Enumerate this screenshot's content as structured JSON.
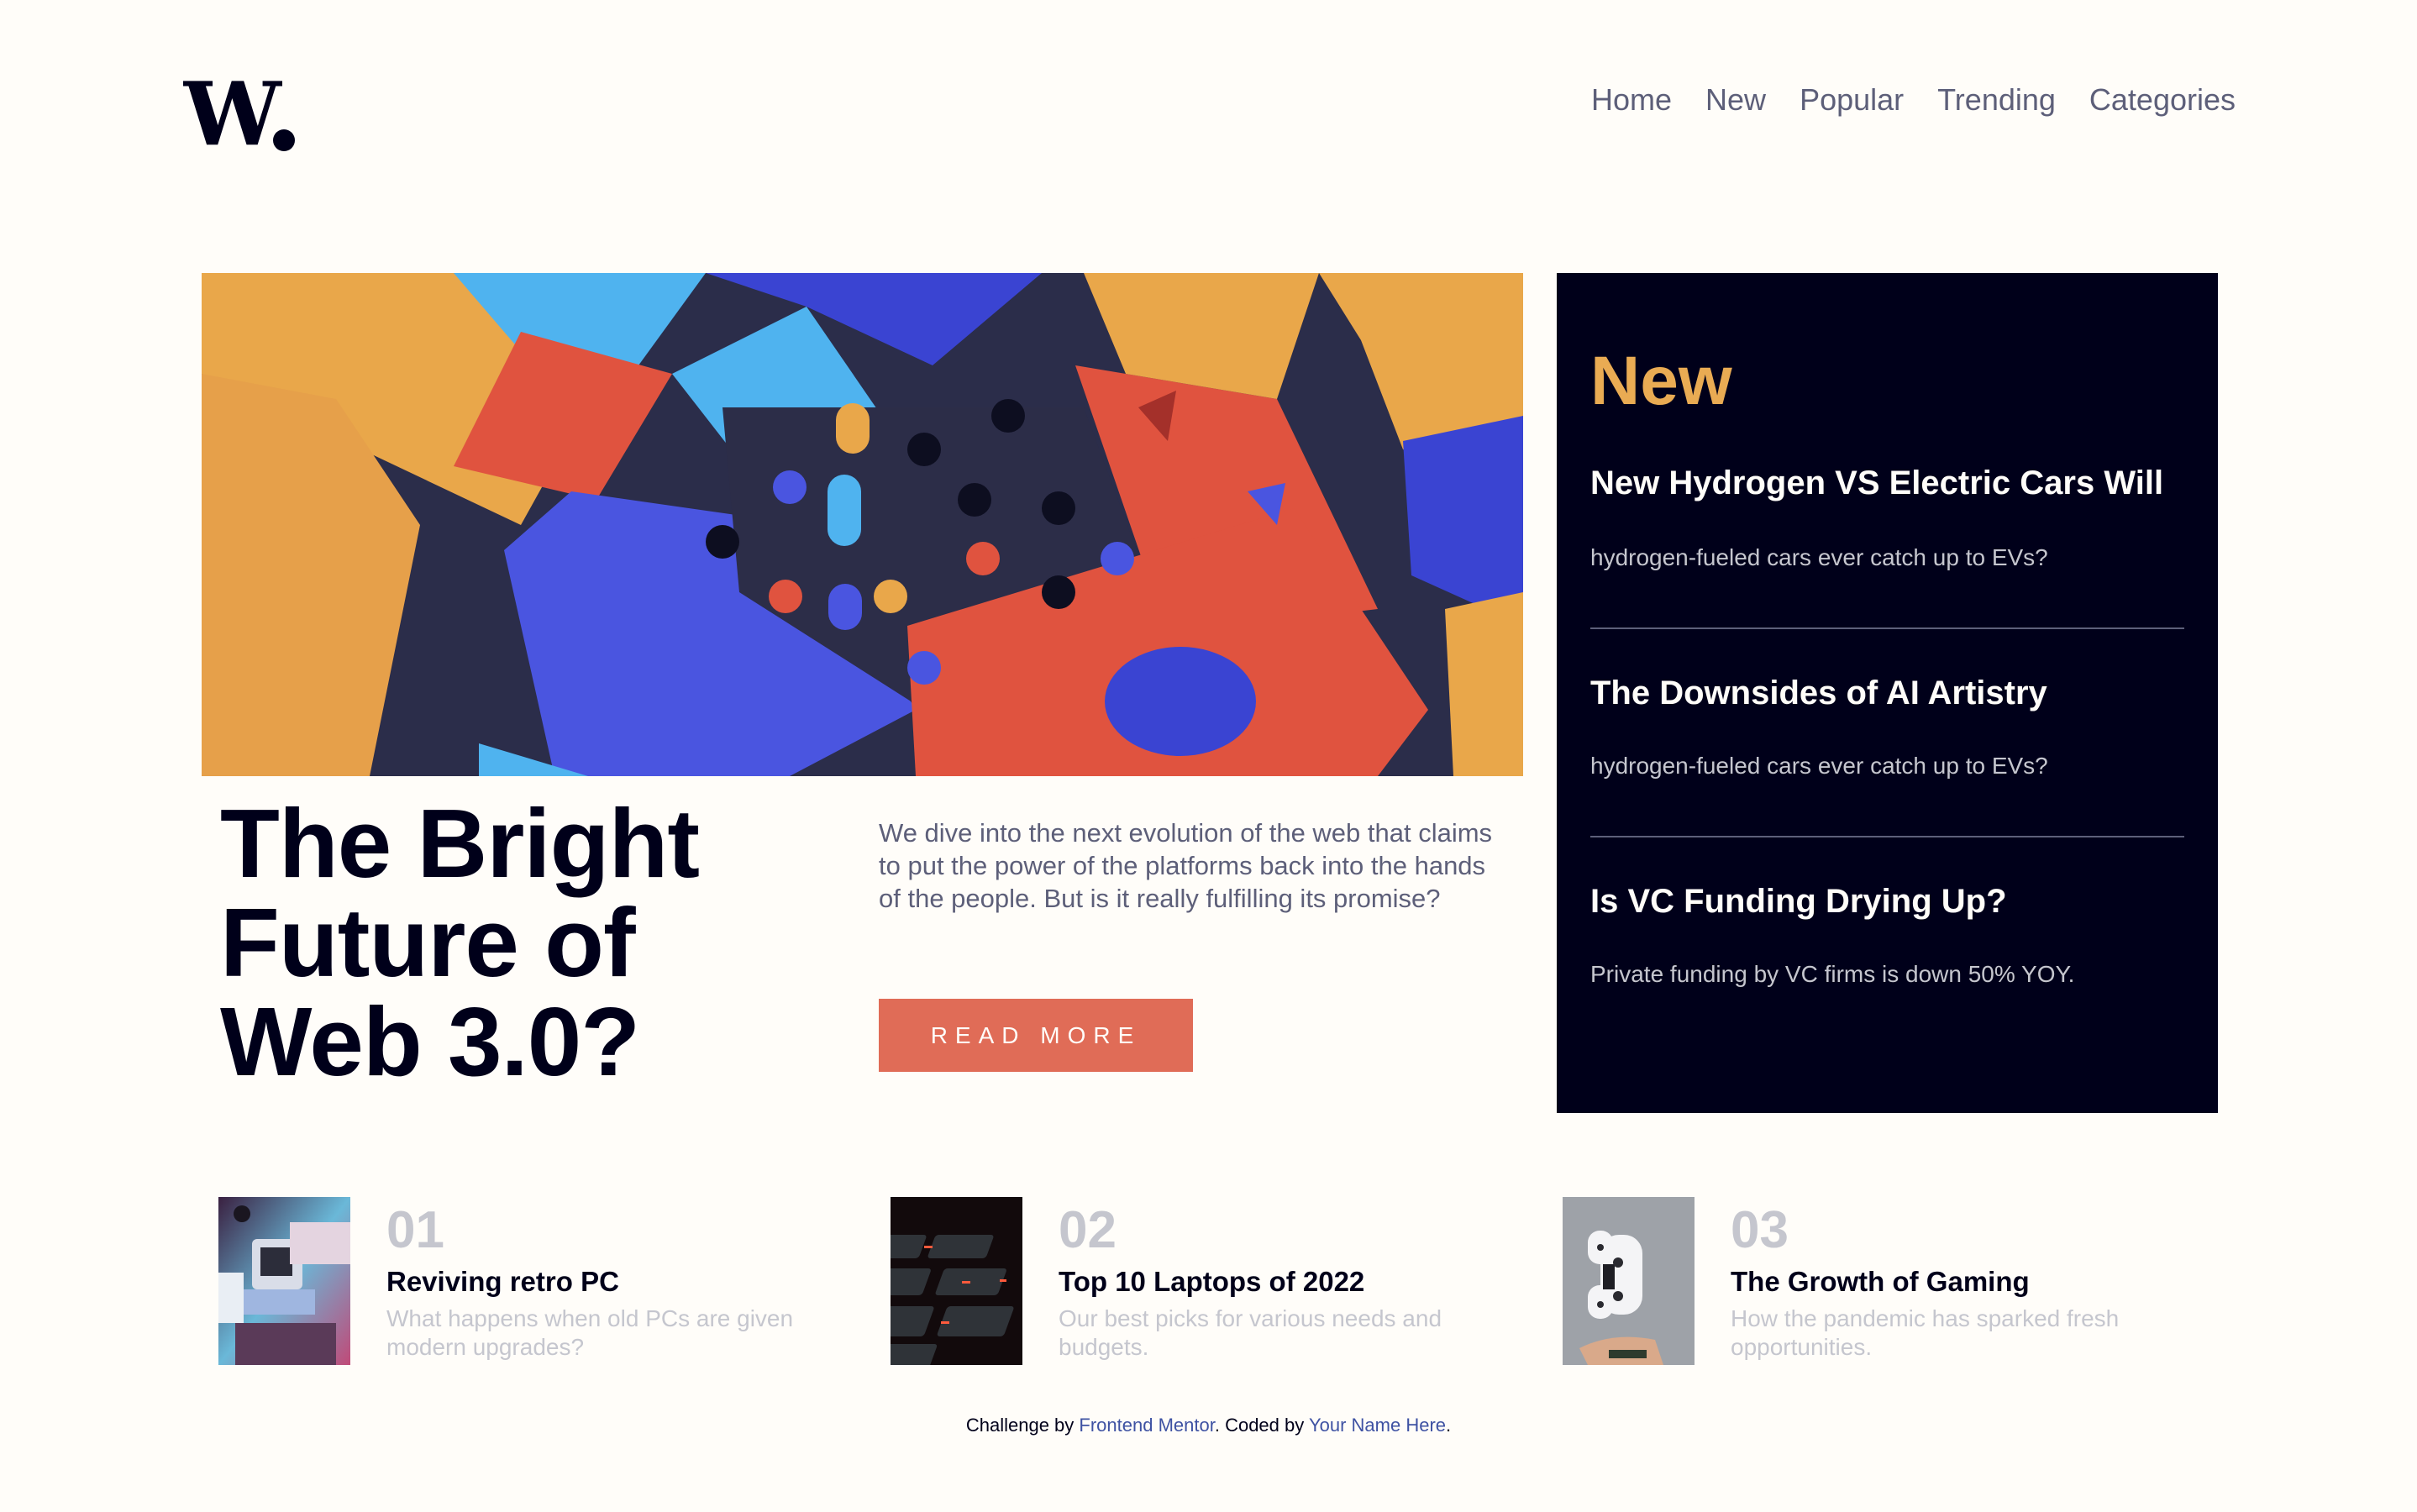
{
  "brand": {
    "logo_text": "W."
  },
  "nav": {
    "items": [
      {
        "label": "Home"
      },
      {
        "label": "New"
      },
      {
        "label": "Popular"
      },
      {
        "label": "Trending"
      },
      {
        "label": "Categories"
      }
    ]
  },
  "hero": {
    "image_alt": "Abstract colorful 3D geometric blocks and pegboard",
    "title": "The Bright Future of Web 3.0?",
    "description": "We dive into the next evolution of the web that claims to put the power of the platforms back into the hands of the people. But is it really fulfilling its promise?",
    "button_label": "READ MORE"
  },
  "new_panel": {
    "title": "New",
    "items": [
      {
        "title": "New Hydrogen VS Electric Cars Will",
        "description": "hydrogen-fueled cars ever catch up to EVs?"
      },
      {
        "title": "The Downsides of AI Artistry",
        "description": "hydrogen-fueled cars ever catch up to EVs?"
      },
      {
        "title": "Is VC Funding Drying Up?",
        "description": "Private funding by VC firms is down 50% YOY."
      }
    ]
  },
  "articles": [
    {
      "number": "01",
      "title": "Reviving retro PC",
      "description": "What happens when old PCs are given modern upgrades?",
      "image_alt": "Retro computers"
    },
    {
      "number": "02",
      "title": "Top 10 Laptops of 2022",
      "description": "Our best picks for various needs and budgets.",
      "image_alt": "Laptop keyboard with red backlight"
    },
    {
      "number": "03",
      "title": "The Growth of Gaming",
      "description": "How the pandemic has sparked fresh opportunities.",
      "image_alt": "Game controller floating above hand"
    }
  ],
  "footer": {
    "prefix": "Challenge by ",
    "link1": "Frontend Mentor",
    "middle": ". Coded by ",
    "link2": "Your Name Here",
    "suffix": "."
  },
  "colors": {
    "background": "#fffdf9",
    "dark_navy": "#00001a",
    "accent_orange": "#e9ab53",
    "accent_red": "#e06c57",
    "grayish_blue": "#5d5f79",
    "light_gray": "#c5c6ce"
  }
}
